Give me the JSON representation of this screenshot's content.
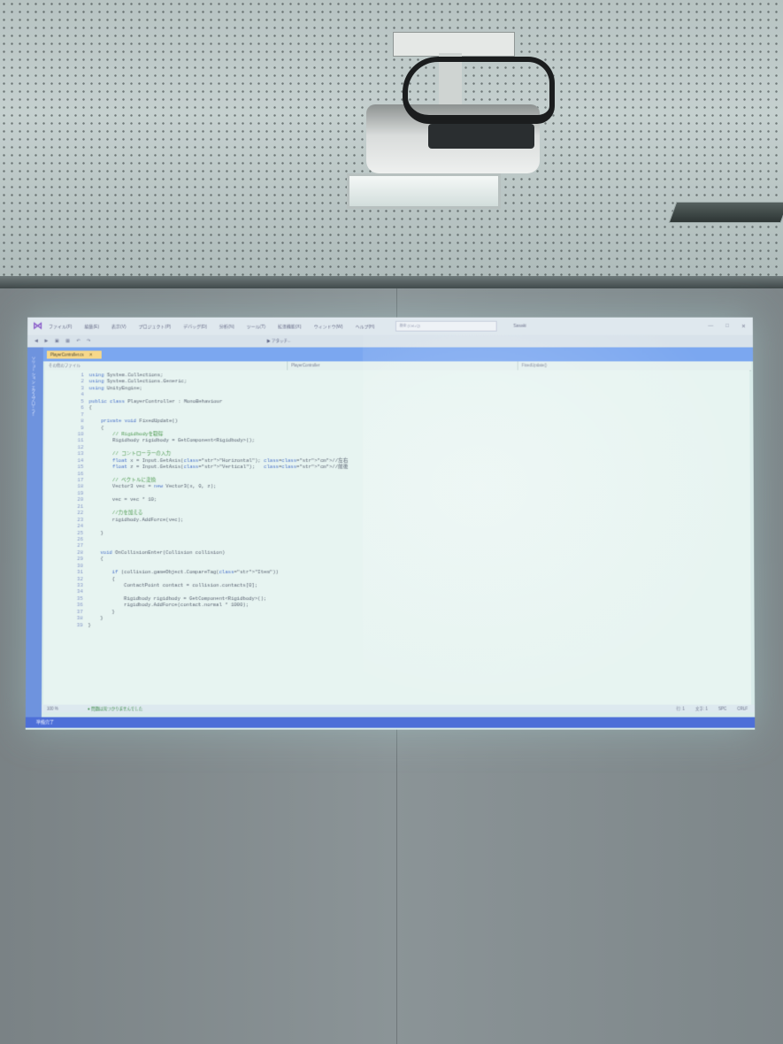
{
  "ide": {
    "menu": [
      "ファイル(F)",
      "編集(E)",
      "表示(V)",
      "プロジェクト(P)",
      "デバッグ(D)",
      "分析(N)",
      "ツール(T)",
      "拡張機能(X)",
      "ウィンドウ(W)",
      "ヘルプ(H)"
    ],
    "search_placeholder": "検索 (Ctrl+Q)",
    "project_name": "Sasaki",
    "attach_label": "▶ アタッチ...",
    "side_label": "ソリューション エクスプローラー",
    "tab_label": "PlayerController.cs",
    "path_segments": [
      "その他のファイル",
      "PlayerController",
      "FixedUpdate()"
    ],
    "code_lines": [
      "using System.Collections;",
      "using System.Collections.Generic;",
      "using UnityEngine;",
      "",
      "public class PlayerController : MonoBehaviour",
      "{",
      "",
      "    private void FixedUpdate()",
      "    {",
      "        // Rigidbodyを取得",
      "        Rigidbody rigidbody = GetComponent<Rigidbody>();",
      "",
      "        // コントローラーの入力",
      "        float x = Input.GetAxis(\"Horizontal\"); //左右",
      "        float z = Input.GetAxis(\"Vertical\");   //前後",
      "",
      "        // ベクトルに変換",
      "        Vector3 vec = new Vector3(x, 0, z);",
      "",
      "        vec = vec * 10;",
      "",
      "        //力を加える",
      "        rigidbody.AddForce(vec);",
      "",
      "    }",
      "",
      "",
      "    void OnCollisionEnter(Collision collision)",
      "    {",
      "",
      "        if (collision.gameObject.CompareTag(\"Item\"))",
      "        {",
      "            ContactPoint contact = collision.contacts[0];",
      "",
      "            Rigidbody rigidbody = GetComponent<Rigidbody>();",
      "            rigidbody.AddForce(contact.normal * 1000);",
      "        }",
      "    }",
      "}"
    ],
    "zoom": "100 %",
    "issues_text": "問題は見つかりませんでした",
    "cursor_line": "行: 1",
    "cursor_col": "文字: 1",
    "indent_mode": "SPC",
    "line_ending": "CRLF",
    "status_ready": "準備完了"
  },
  "colors": {
    "screen_background": "#d9ecea",
    "ide_accent": "#4d6fd8",
    "tab_highlight": "#f7d88a"
  }
}
